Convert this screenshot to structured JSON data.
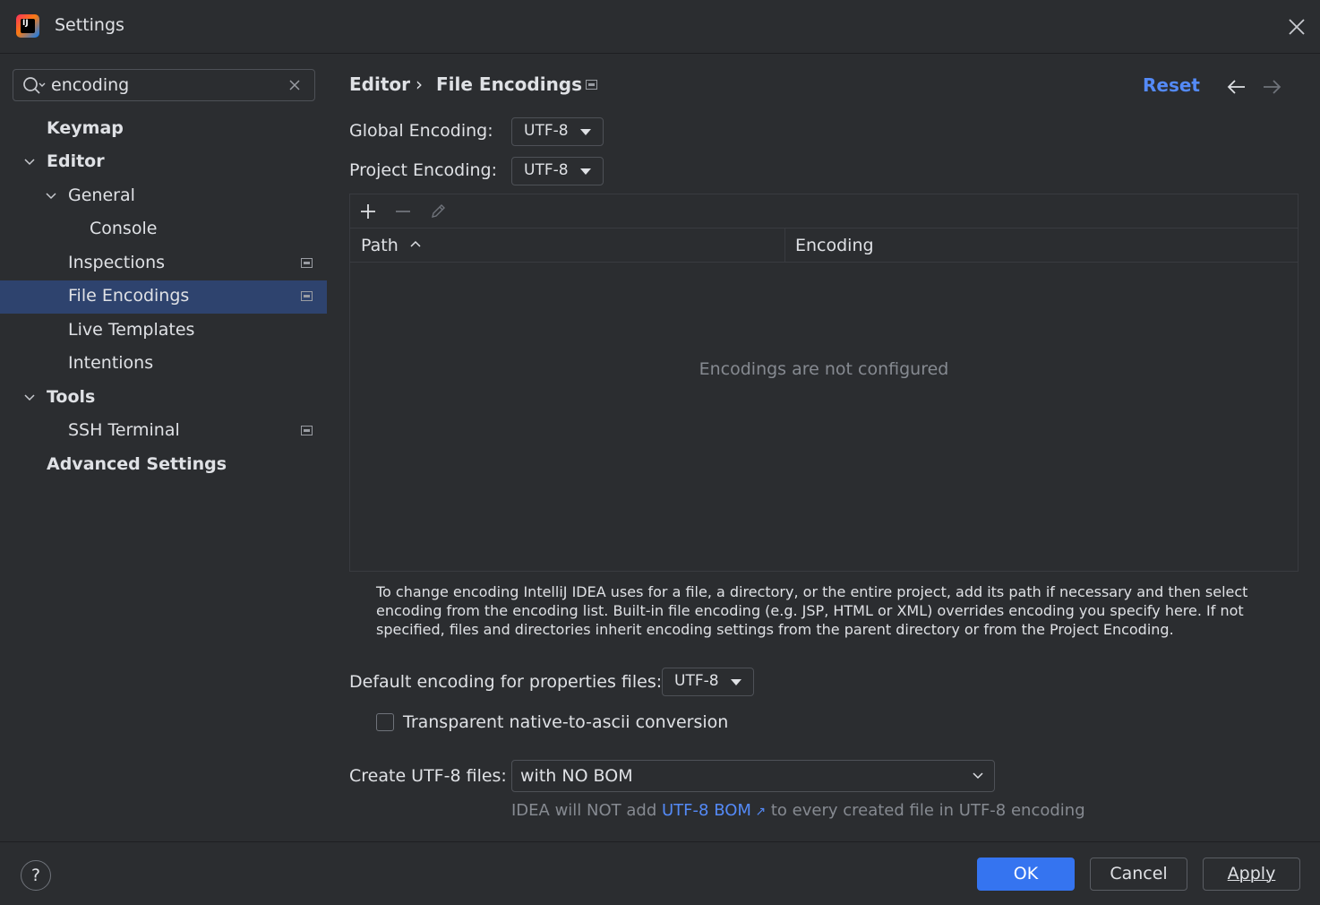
{
  "window": {
    "title": "Settings",
    "logo_text": "IJ"
  },
  "search": {
    "value": "encoding"
  },
  "sidebar": {
    "items": [
      {
        "label": "Keymap"
      },
      {
        "label": "Editor"
      },
      {
        "label": "General"
      },
      {
        "label": "Console"
      },
      {
        "label": "Inspections"
      },
      {
        "label": "File Encodings"
      },
      {
        "label": "Live Templates"
      },
      {
        "label": "Intentions"
      },
      {
        "label": "Tools"
      },
      {
        "label": "SSH Terminal"
      },
      {
        "label": "Advanced Settings"
      }
    ]
  },
  "header": {
    "breadcrumb_parent": "Editor",
    "breadcrumb_sep": "›",
    "breadcrumb_current": "File Encodings",
    "reset_label": "Reset"
  },
  "encodings": {
    "global_label": "Global Encoding:",
    "global_value": "UTF-8",
    "project_label": "Project Encoding:",
    "project_value": "UTF-8"
  },
  "table": {
    "columns": [
      "Path",
      "Encoding"
    ],
    "empty_text": "Encodings are not configured"
  },
  "help_text": "To change encoding IntelliJ IDEA uses for a file, a directory, or the entire project, add its path if necessary and then select encoding from the encoding list. Built-in file encoding (e.g. JSP, HTML or XML) overrides encoding you specify here. If not specified, files and directories inherit encoding settings from the parent directory or from the Project Encoding.",
  "properties": {
    "label": "Default encoding for properties files:",
    "value": "UTF-8",
    "native_to_ascii_label": "Transparent native-to-ascii conversion",
    "native_to_ascii_checked": false
  },
  "bom": {
    "label": "Create UTF-8 files:",
    "value": "with NO BOM",
    "note_prefix": "IDEA will NOT add",
    "note_link": "UTF-8 BOM",
    "note_suffix": "to every created file in UTF-8 encoding"
  },
  "footer": {
    "help_label": "?",
    "ok_label": "OK",
    "cancel_label": "Cancel",
    "apply_label": "Apply"
  },
  "colors": {
    "background": "#2b2d30",
    "selection": "#2e436e",
    "link": "#548af7",
    "primary_button": "#3574f0",
    "muted_text": "#868a91"
  }
}
